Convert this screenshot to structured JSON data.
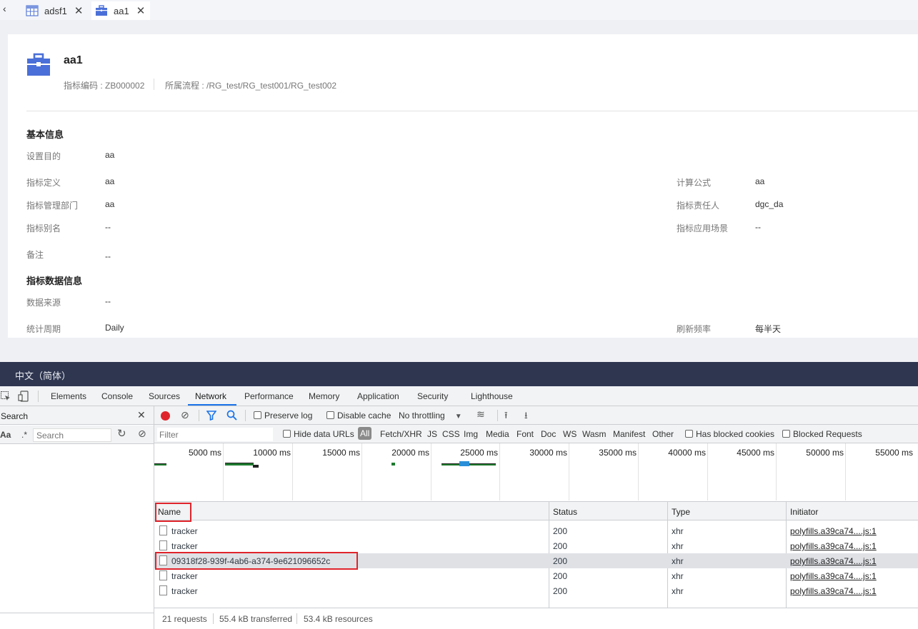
{
  "app": {
    "tabs": [
      {
        "label": "adsf1",
        "icon": "table-icon"
      },
      {
        "label": "aa1",
        "icon": "briefcase-icon"
      }
    ],
    "header": {
      "title": "aa1",
      "code_label": "指标编码 : ZB000002",
      "flow_label": "所属流程 : /RG_test/RG_test001/RG_test002"
    },
    "basic": {
      "title": "基本信息",
      "fields": {
        "purpose": {
          "label": "设置目的",
          "value": "aa"
        },
        "definition": {
          "label": "指标定义",
          "value": "aa"
        },
        "formula": {
          "label": "计算公式",
          "value": "aa"
        },
        "dept": {
          "label": "指标管理部门",
          "value": "aa"
        },
        "owner": {
          "label": "指标责任人",
          "value": "dgc_da"
        },
        "alias": {
          "label": "指标别名",
          "value": "--"
        },
        "scene": {
          "label": "指标应用场景",
          "value": "--"
        },
        "remark": {
          "label": "备注",
          "value": "--"
        }
      }
    },
    "data_info": {
      "title": "指标数据信息",
      "fields": {
        "source": {
          "label": "数据来源",
          "value": "--"
        },
        "period": {
          "label": "统计周期",
          "value": "Daily"
        },
        "refresh": {
          "label": "刷新频率",
          "value": "每半天"
        }
      }
    },
    "language": "中文（简体）"
  },
  "devtools": {
    "tabs": [
      "Elements",
      "Console",
      "Sources",
      "Network",
      "Performance",
      "Memory",
      "Application",
      "Security",
      "Lighthouse"
    ],
    "active_tab": "Network",
    "search": {
      "title": "Search",
      "aa": "Aa",
      "regex": ".*",
      "placeholder": "Search"
    },
    "toolbar": {
      "preserve_log": "Preserve log",
      "disable_cache": "Disable cache",
      "throttling": "No throttling"
    },
    "filter": {
      "placeholder": "Filter",
      "hide_data_urls": "Hide data URLs",
      "types": [
        "All",
        "Fetch/XHR",
        "JS",
        "CSS",
        "Img",
        "Media",
        "Font",
        "Doc",
        "WS",
        "Wasm",
        "Manifest",
        "Other"
      ],
      "has_blocked_cookies": "Has blocked cookies",
      "blocked_requests": "Blocked Requests"
    },
    "timeline_ticks": [
      "5000 ms",
      "10000 ms",
      "15000 ms",
      "20000 ms",
      "25000 ms",
      "30000 ms",
      "35000 ms",
      "40000 ms",
      "45000 ms",
      "50000 ms",
      "55000 ms"
    ],
    "columns": {
      "name": "Name",
      "status": "Status",
      "type": "Type",
      "initiator": "Initiator"
    },
    "rows": [
      {
        "name": "tracker",
        "status": "200",
        "type": "xhr",
        "initiator": "polyfills.a39ca74....js:1"
      },
      {
        "name": "tracker",
        "status": "200",
        "type": "xhr",
        "initiator": "polyfills.a39ca74....js:1"
      },
      {
        "name": "09318f28-939f-4ab6-a374-9e621096652c",
        "status": "200",
        "type": "xhr",
        "initiator": "polyfills.a39ca74....js:1"
      },
      {
        "name": "tracker",
        "status": "200",
        "type": "xhr",
        "initiator": "polyfills.a39ca74....js:1"
      },
      {
        "name": "tracker",
        "status": "200",
        "type": "xhr",
        "initiator": "polyfills.a39ca74....js:1"
      }
    ],
    "status": {
      "requests": "21 requests",
      "transferred": "55.4 kB transferred",
      "resources": "53.4 kB resources"
    }
  }
}
